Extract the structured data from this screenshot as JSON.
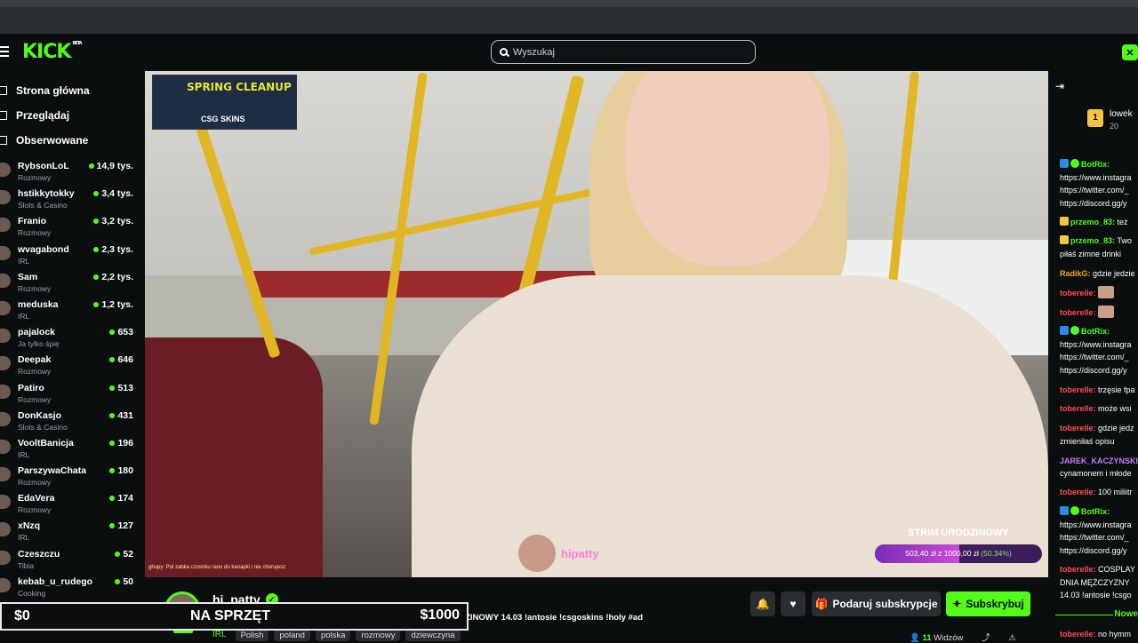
{
  "app": {
    "logo": "KICK",
    "logo_sup": "BETA",
    "search_placeholder": "Wyszukaj",
    "top_right_icon": "x-icon"
  },
  "colors": {
    "accent": "#53fc18",
    "bg": "#0b0e0f",
    "chat_name_green": "#53fc18",
    "chat_name_red": "#ff4d4d",
    "chat_name_purple": "#c77dff"
  },
  "nav": [
    {
      "label": "Strona główna",
      "icon": "home-icon"
    },
    {
      "label": "Przeglądaj",
      "icon": "browse-icon"
    },
    {
      "label": "Obserwowane",
      "icon": "heart-icon"
    }
  ],
  "channels": [
    {
      "name": "RybsonLoL",
      "category": "Rozmowy",
      "viewers": "14,9 tys."
    },
    {
      "name": "hstikkytokky",
      "category": "Slots & Casino",
      "viewers": "3,4 tys."
    },
    {
      "name": "Franio",
      "category": "Rozmowy",
      "viewers": "3,2 tys."
    },
    {
      "name": "wvagabond",
      "category": "IRL",
      "viewers": "2,3 tys."
    },
    {
      "name": "Sam",
      "category": "Rozmowy",
      "viewers": "2,2 tys."
    },
    {
      "name": "meduska",
      "category": "IRL",
      "viewers": "1,2 tys."
    },
    {
      "name": "pajalock",
      "category": "Ja tylko śpię",
      "viewers": "653"
    },
    {
      "name": "Deepak",
      "category": "Rozmowy",
      "viewers": "646"
    },
    {
      "name": "Patiro",
      "category": "Rozmowy",
      "viewers": "513"
    },
    {
      "name": "DonKasjo",
      "category": "Slots & Casino",
      "viewers": "431"
    },
    {
      "name": "VooltBanicja",
      "category": "IRL",
      "viewers": "196"
    },
    {
      "name": "ParszywaChata",
      "category": "Rozmowy",
      "viewers": "180"
    },
    {
      "name": "EdaVera",
      "category": "Rozmowy",
      "viewers": "174"
    },
    {
      "name": "xNzq",
      "category": "IRL",
      "viewers": "127"
    },
    {
      "name": "Czeszczu",
      "category": "Tibia",
      "viewers": "52"
    },
    {
      "name": "kebab_u_rudego",
      "category": "Cooking",
      "viewers": "50"
    },
    {
      "name": "hi_patty",
      "category": "",
      "viewers": "11"
    }
  ],
  "video": {
    "promo_title": "SPRING CLEANUP",
    "promo_brand": "CSG SKINS",
    "ticker": "ghupy: Pol zabka czosnku rano do kanapki i nie chorujesz",
    "watermark": "hipatty",
    "goal_title": "STRIM URODZINOWY",
    "goal_text_prefix": "503,40 zł z 1000,00 zł ",
    "goal_pct": "(50.34%)",
    "goal_progress": 0.5034
  },
  "stream": {
    "channel": "hi_patty",
    "live": "LIVE",
    "title": "OCHRONA WOMAN Z OKAZJI DNIA MĘŻCZYZNY STRIM URODZINOWY 14.03 !antosie !csgoskins !holy #ad",
    "category": "IRL",
    "tags": [
      "Polish",
      "poland",
      "polska",
      "rozmowy",
      "dziewczyna"
    ],
    "viewers_count": "11",
    "viewers_label": "Widzów",
    "gift_label": "Podaruj subskrypcje",
    "subscribe_label": "Subskrybuj"
  },
  "overlay": {
    "left": "$0",
    "middle": "NA SPRZĘT",
    "right": "$1000"
  },
  "chat": {
    "pinned_user": "lowek",
    "pinned_badge": "1",
    "pinned_count": "20",
    "new_label": "Nowe",
    "messages": [
      {
        "user": "BotRix:",
        "text": "",
        "color": "#53fc18"
      },
      {
        "user": "",
        "text": "https://www.instagra",
        "color": ""
      },
      {
        "user": "",
        "text": "https://twitter.com/_",
        "color": ""
      },
      {
        "user": "",
        "text": "https://discord.gg/y",
        "color": ""
      },
      {
        "user": "przemo_83:",
        "text": " też",
        "color": "#53fc18"
      },
      {
        "user": "przemo_83:",
        "text": " Two",
        "color": "#53fc18"
      },
      {
        "user": "",
        "text": "piłaś zimne drinki",
        "color": ""
      },
      {
        "user": "RadikG:",
        "text": " gdzie jedzie",
        "color": "#f5a623"
      },
      {
        "user": "toberelle:",
        "text": "",
        "color": "#ff4d4d"
      },
      {
        "user": "toberelle:",
        "text": "",
        "color": "#ff4d4d"
      },
      {
        "user": "BotRix:",
        "text": "",
        "color": "#53fc18"
      },
      {
        "user": "",
        "text": "https://www.instagra",
        "color": ""
      },
      {
        "user": "",
        "text": "https://twitter.com/_",
        "color": ""
      },
      {
        "user": "",
        "text": "https://discord.gg/y",
        "color": ""
      },
      {
        "user": "toberelle:",
        "text": " trzęsie fpa",
        "color": "#ff4d4d"
      },
      {
        "user": "toberelle:",
        "text": " może wsi",
        "color": "#ff4d4d"
      },
      {
        "user": "toberelle:",
        "text": " gdzie jedz",
        "color": "#ff4d4d"
      },
      {
        "user": "",
        "text": "zmieniłaś opisu",
        "color": ""
      },
      {
        "user": "JAREK_KACZYNSKI",
        "text": "",
        "color": "#c77dff"
      },
      {
        "user": "",
        "text": "cynamonem i młode",
        "color": ""
      },
      {
        "user": "toberelle:",
        "text": " 100 miliitr",
        "color": "#ff4d4d"
      },
      {
        "user": "BotRix:",
        "text": "",
        "color": "#53fc18"
      },
      {
        "user": "",
        "text": "https://www.instagra",
        "color": ""
      },
      {
        "user": "",
        "text": "https://twitter.com/_",
        "color": ""
      },
      {
        "user": "",
        "text": "https://discord.gg/y",
        "color": ""
      },
      {
        "user": "toberelle:",
        "text": " COSPLAY",
        "color": "#ff4d4d"
      },
      {
        "user": "",
        "text": "DNIA MĘŻCZYZNY",
        "color": ""
      },
      {
        "user": "",
        "text": "14.03 !antosie !csgo",
        "color": ""
      },
      {
        "user": "toberelle:",
        "text": " no hymm",
        "color": "#ff4d4d"
      }
    ]
  }
}
